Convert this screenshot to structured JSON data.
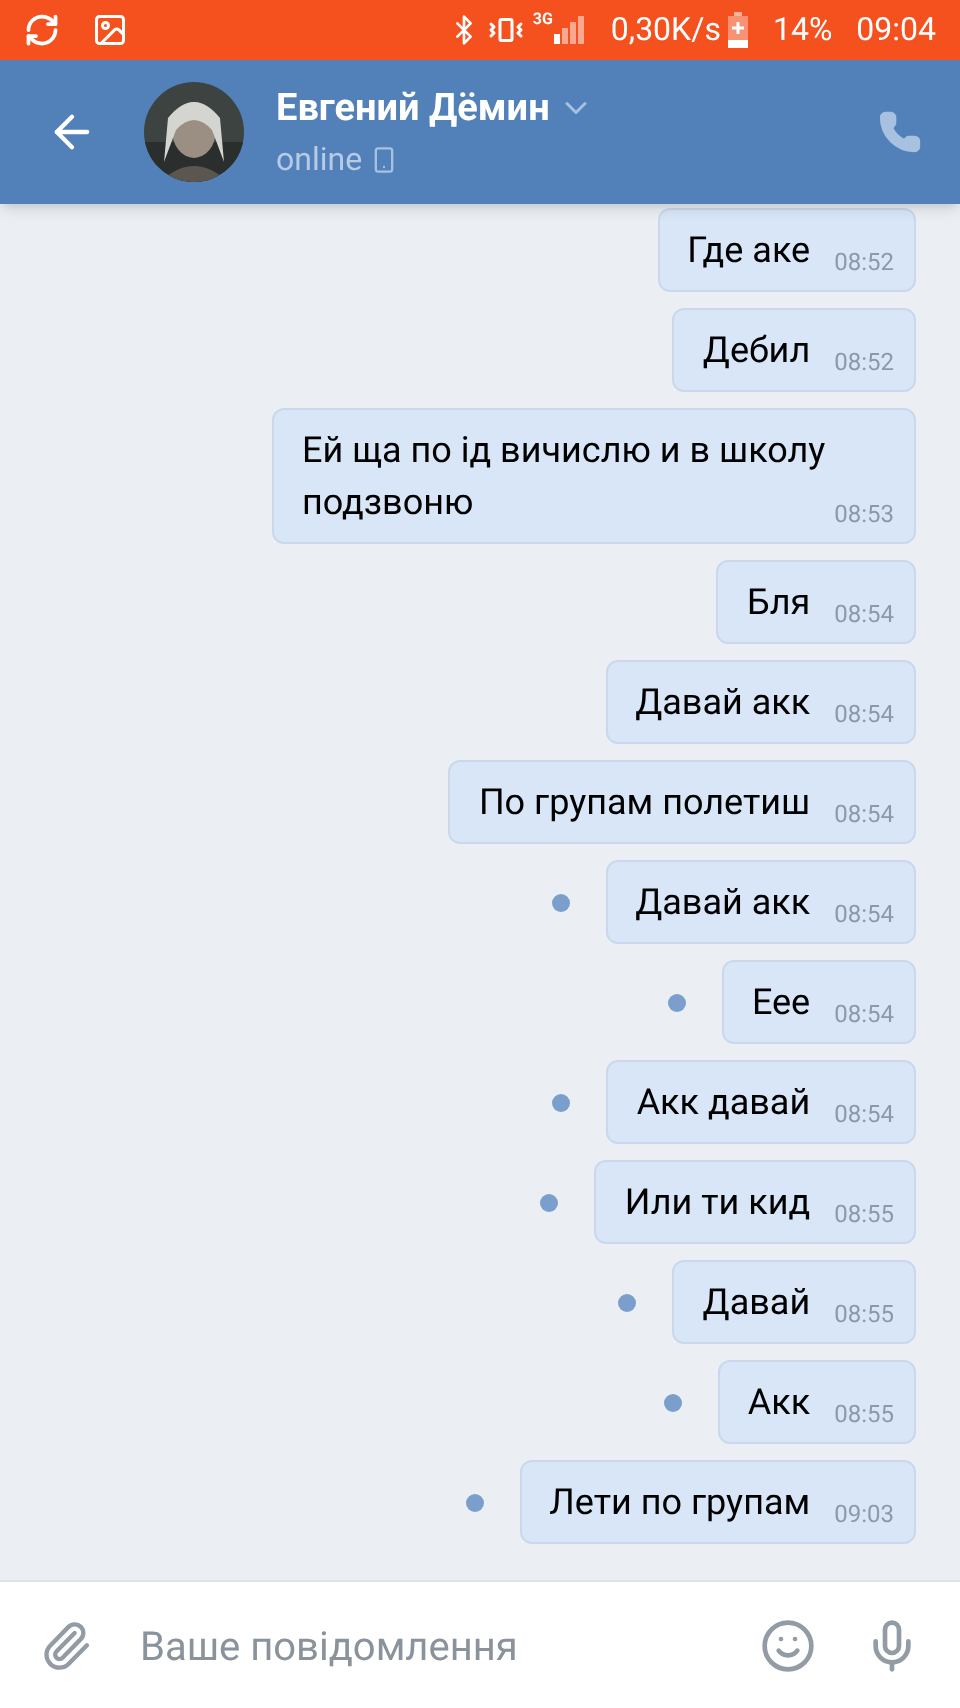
{
  "status_bar": {
    "network": "3G",
    "speed": "0,30K/s",
    "battery": "14%",
    "time": "09:04"
  },
  "header": {
    "name": "Евгений Дёмин",
    "presence": "online"
  },
  "messages": [
    {
      "text": "Где аке",
      "time": "08:52",
      "unread": false
    },
    {
      "text": "Дебил",
      "time": "08:52",
      "unread": false
    },
    {
      "text": "Ей ща по ід вичислю и в школу подзвоню",
      "time": "08:53",
      "unread": false
    },
    {
      "text": "Бля",
      "time": "08:54",
      "unread": false
    },
    {
      "text": "Давай акк",
      "time": "08:54",
      "unread": false
    },
    {
      "text": "По групам полетиш",
      "time": "08:54",
      "unread": false
    },
    {
      "text": "Давай акк",
      "time": "08:54",
      "unread": true
    },
    {
      "text": "Еее",
      "time": "08:54",
      "unread": true
    },
    {
      "text": "Акк давай",
      "time": "08:54",
      "unread": true
    },
    {
      "text": "Или ти кид",
      "time": "08:55",
      "unread": true
    },
    {
      "text": "Давай",
      "time": "08:55",
      "unread": true
    },
    {
      "text": "Акк",
      "time": "08:55",
      "unread": true
    },
    {
      "text": "Лети по групам",
      "time": "09:03",
      "unread": true
    }
  ],
  "composer": {
    "placeholder": "Ваше повідомлення"
  }
}
